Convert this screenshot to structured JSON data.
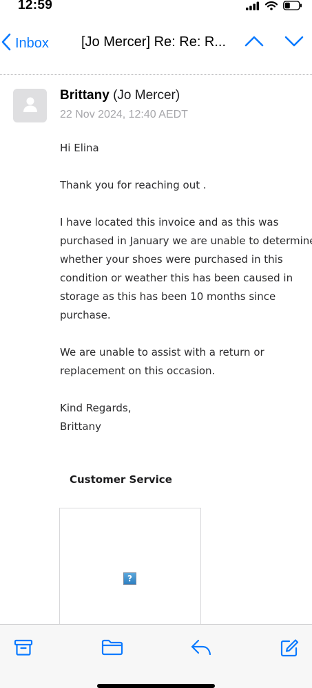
{
  "status_bar": {
    "time": "12:59",
    "icons": [
      "signal-icon",
      "wifi-icon",
      "battery-icon"
    ]
  },
  "nav": {
    "back_label": "Inbox",
    "title": "[Jo Mercer] Re: Re: R...",
    "icons": [
      "chevron-left-icon",
      "chevron-up-icon",
      "chevron-down-icon"
    ],
    "accent_color": "#0a7aff"
  },
  "message": {
    "sender_name": "Brittany",
    "sender_alias": "(Jo Mercer)",
    "date": "22 Nov 2024, 12:40 AEDT",
    "greeting": "Hi Elina",
    "line_thanks": "Thank you for reaching out .",
    "para1_lines": [
      "I have located this invoice and as this was",
      "purchased in January we are unable to determine",
      "whether your shoes were purchased in this",
      "condition or weather this has been caused in",
      "storage as this has been 10 months since",
      "purchase."
    ],
    "para2_lines": [
      "We are unable to assist with a return or",
      "replacement on this occasion."
    ],
    "closing": "Kind Regards,",
    "signoff": "Brittany",
    "signature_title": "Customer Service",
    "broken_image_glyph": "?"
  },
  "toolbar": {
    "icons": [
      "archive-icon",
      "folder-icon",
      "reply-icon",
      "compose-icon"
    ],
    "accent_color": "#0a7aff"
  }
}
